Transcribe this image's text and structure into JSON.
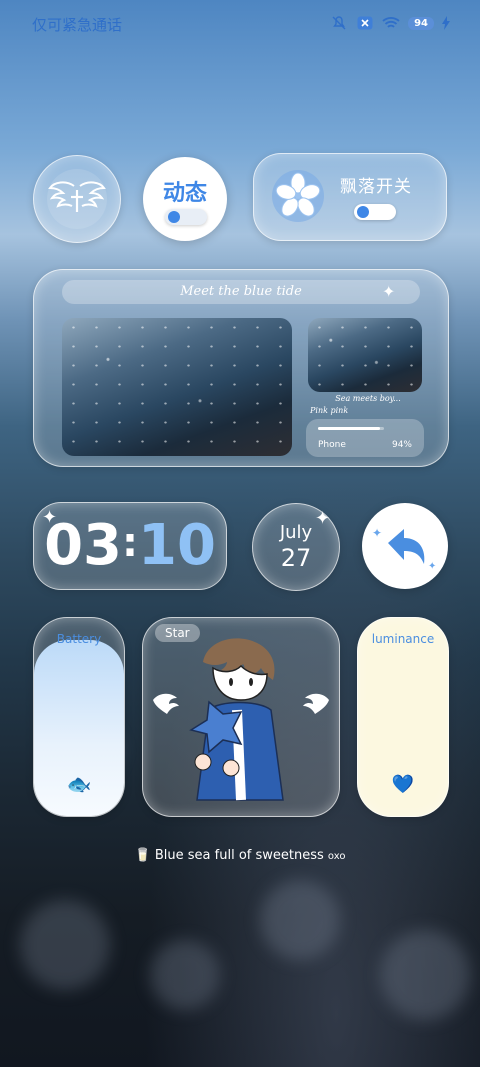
{
  "status": {
    "emergency_text": "仅可紧急通话",
    "battery": "94",
    "icons": [
      "mute-icon",
      "close-box-icon",
      "wifi-icon",
      "battery-icon",
      "charging-icon"
    ]
  },
  "widgets": {
    "dynamic_label": "动态",
    "petal_label": "飘落开关",
    "banner_title": "Meet the blue tide",
    "photo_caption": "Sea meets boy...",
    "photo_subcaption": "Pink pink",
    "phone_label": "Phone",
    "phone_percent": "94%",
    "phone_level": 0.94,
    "clock_hours": "03",
    "clock_sep": ":",
    "clock_minutes": "10",
    "month": "July",
    "day": "27",
    "battery_label": "Battery",
    "star_label": "Star",
    "luminance_label": "luminance",
    "footer": "Blue sea full of sweetness",
    "footer_suffix": "oxo"
  },
  "colors": {
    "accent": "#3f87e6",
    "clock_minutes": "#8fc1f5",
    "clock_hours": "#ffffff"
  }
}
